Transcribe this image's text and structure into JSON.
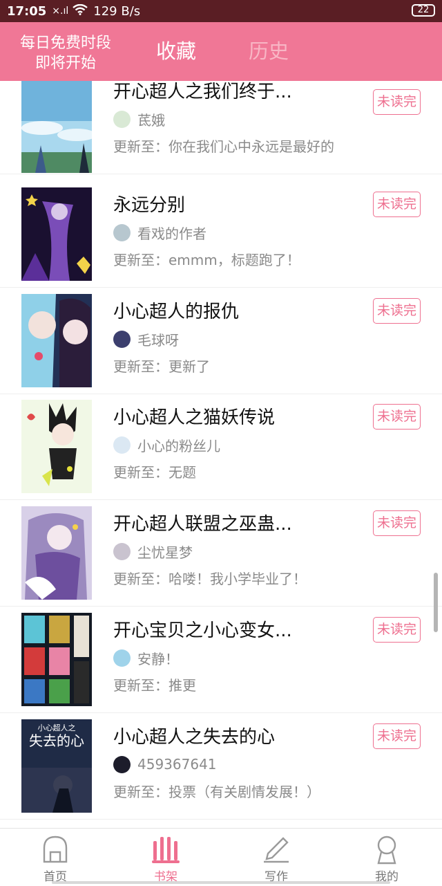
{
  "status_bar": {
    "time": "17:05",
    "signal": "×.ıl",
    "wifi": "📶",
    "net_speed": "129 B/s",
    "battery": "22"
  },
  "header": {
    "promo_line1": "每日免费时段",
    "promo_line2": "即将开始",
    "tab_favorites": "收藏",
    "tab_history": "历史",
    "colors": {
      "bar": "#f07796",
      "active": "#ffffff",
      "inactive": "#f8b6c5"
    }
  },
  "badge_label": "未读完",
  "items": [
    {
      "title": "开心超人之我们终于...",
      "author": "茋娥",
      "update": "更新至：你在我们心中永远是最好的"
    },
    {
      "title": "永远分别",
      "author": "看戏的作者",
      "update": "更新至：emmm，标题跑了！"
    },
    {
      "title": "小心超人的报仇",
      "author": "毛球呀",
      "update": "更新至：更新了"
    },
    {
      "title": "小心超人之猫妖传说",
      "author": "小心的粉丝儿",
      "update": "更新至：无题"
    },
    {
      "title": "开心超人联盟之巫蛊...",
      "author": "尘忧星梦",
      "update": "更新至：哈喽！我小学毕业了！"
    },
    {
      "title": "开心宝贝之小心变女...",
      "author": "安静！",
      "update": "更新至：推更"
    },
    {
      "title": "小心超人之失去的心",
      "author": "459367641",
      "update": "更新至：投票（有关剧情发展！）",
      "cover_text_line1": "小心超人之",
      "cover_text_line2": "失去的心"
    }
  ],
  "bottom_nav": [
    {
      "label": "首页",
      "icon": "home-icon"
    },
    {
      "label": "书架",
      "icon": "bookshelf-icon"
    },
    {
      "label": "写作",
      "icon": "pencil-icon"
    },
    {
      "label": "我的",
      "icon": "profile-icon"
    }
  ],
  "accent_color": "#ee6f8f"
}
